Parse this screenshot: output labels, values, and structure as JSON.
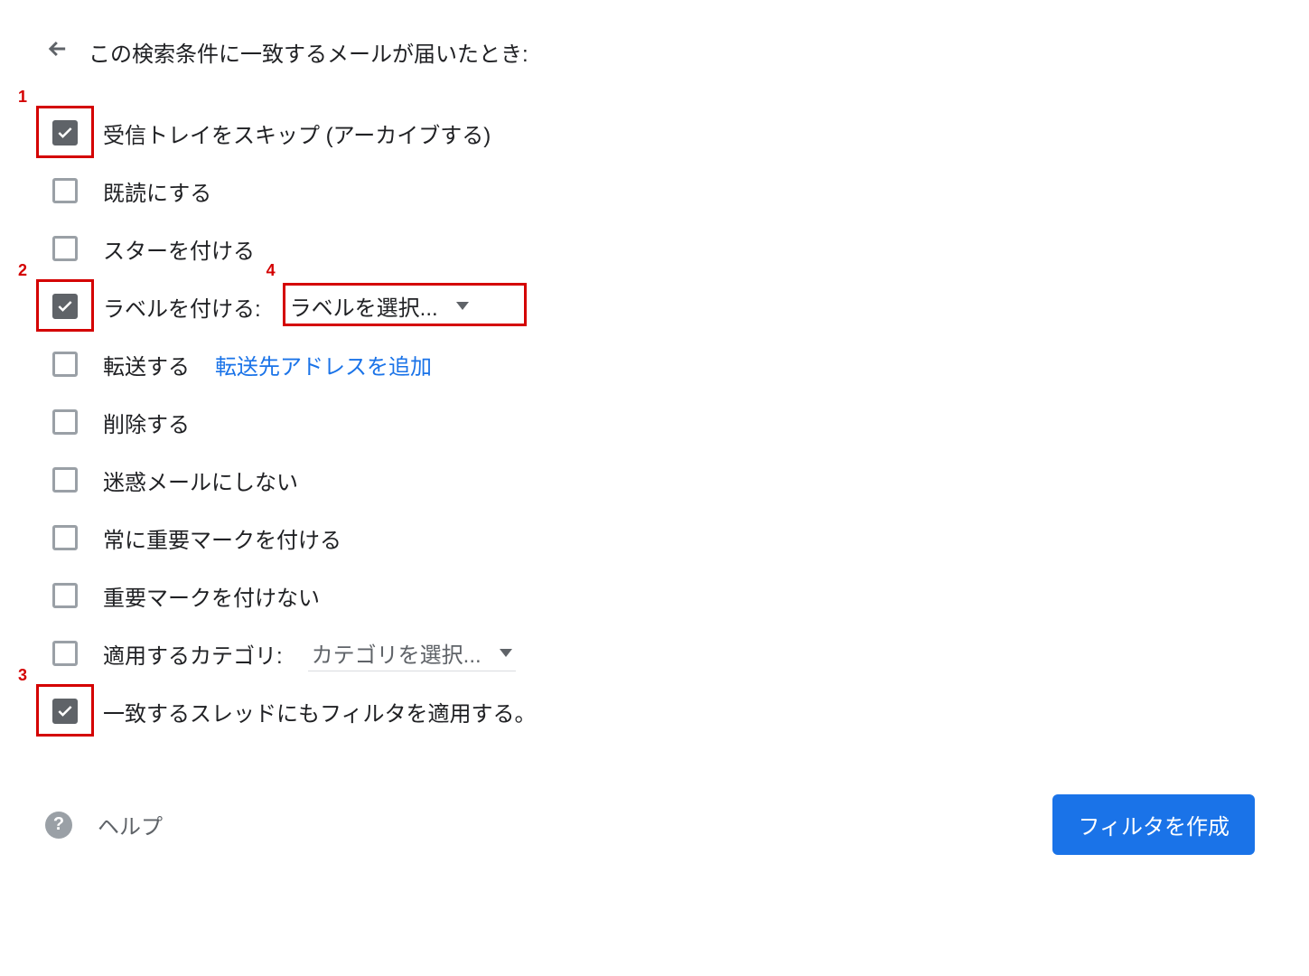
{
  "header": {
    "title": "この検索条件に一致するメールが届いたとき:"
  },
  "options": {
    "skip_inbox": {
      "label": "受信トレイをスキップ (アーカイブする)",
      "checked": true
    },
    "mark_read": {
      "label": "既読にする",
      "checked": false
    },
    "star": {
      "label": "スターを付ける",
      "checked": false
    },
    "apply_label": {
      "label": "ラベルを付ける:",
      "checked": true,
      "dropdown": "ラベルを選択..."
    },
    "forward": {
      "label": "転送する",
      "checked": false,
      "link": "転送先アドレスを追加"
    },
    "delete": {
      "label": "削除する",
      "checked": false
    },
    "never_spam": {
      "label": "迷惑メールにしない",
      "checked": false
    },
    "always_important": {
      "label": "常に重要マークを付ける",
      "checked": false
    },
    "never_important": {
      "label": "重要マークを付けない",
      "checked": false
    },
    "apply_category": {
      "label": "適用するカテゴリ:",
      "checked": false,
      "dropdown": "カテゴリを選択..."
    },
    "also_apply": {
      "label": "一致するスレッドにもフィルタを適用する。",
      "checked": true
    }
  },
  "footer": {
    "help": "ヘルプ",
    "create_button": "フィルタを作成"
  },
  "annotations": {
    "n1": "1",
    "n2": "2",
    "n3": "3",
    "n4": "4"
  }
}
